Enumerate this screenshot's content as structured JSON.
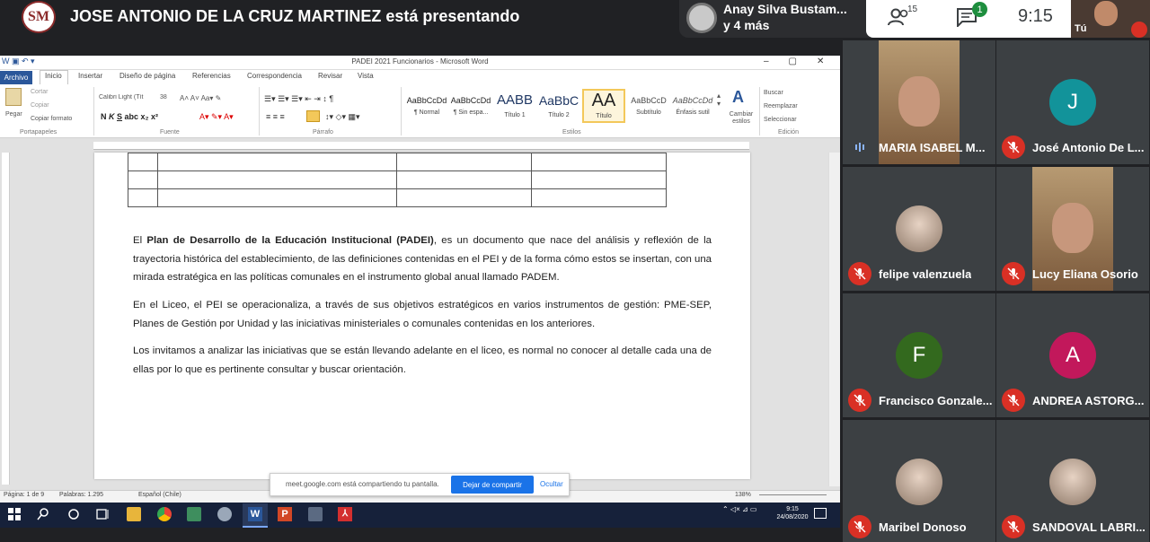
{
  "meet": {
    "presenter_text": "JOSE ANTONIO DE LA CRUZ MARTINEZ está presentando",
    "logo_text": "SM",
    "top_participant": {
      "name": "Anay Silva Bustam...",
      "more": "y 4 más"
    },
    "people_count": "15",
    "chat_badge": "1",
    "clock": "9:15",
    "self_label": "Tú"
  },
  "word": {
    "title": "PADEI 2021 Funcionarios - Microsoft Word",
    "tabs": [
      "Archivo",
      "Inicio",
      "Insertar",
      "Diseño de página",
      "Referencias",
      "Correspondencia",
      "Revisar",
      "Vista"
    ],
    "clipboard": {
      "paste": "Pegar",
      "cut": "Cortar",
      "copy": "Copiar",
      "format": "Copiar formato",
      "title": "Portapapeles"
    },
    "font": {
      "name": "Calibri Light (Tít",
      "size": "38",
      "title": "Fuente"
    },
    "paragraph_title": "Párrafo",
    "styles": [
      {
        "sample": "AaBbCcDd",
        "name": "¶ Normal"
      },
      {
        "sample": "AaBbCcDd",
        "name": "¶ Sin espa..."
      },
      {
        "sample": "AABB",
        "name": "Título 1"
      },
      {
        "sample": "AaBbC",
        "name": "Título 2"
      },
      {
        "sample": "AA",
        "name": "Título"
      },
      {
        "sample": "AaBbCcD",
        "name": "Subtítulo"
      },
      {
        "sample": "AaBbCcDd",
        "name": "Énfasis sutil"
      }
    ],
    "styles_title": "Estilos",
    "change_styles": "Cambiar estilos",
    "editing": {
      "find": "Buscar",
      "replace": "Reemplazar",
      "select": "Seleccionar",
      "title": "Edición"
    },
    "paragraphs": [
      {
        "pre": "El ",
        "bold": "Plan de Desarrollo de la Educación Institucional (PADEI)",
        "post": ", es un documento que nace del análisis y reflexión de la trayectoria histórica del establecimiento, de las definiciones contenidas en el PEI y de la forma cómo estos se insertan, con una mirada estratégica en las políticas comunales en el instrumento global anual llamado PADEM."
      },
      {
        "pre": "En el Liceo, el PEI se operacionaliza, a través de sus objetivos estratégicos en varios instrumentos de gestión: PME-SEP, Planes de Gestión por Unidad y las iniciativas ministeriales o comunales contenidas en los anteriores.",
        "bold": "",
        "post": ""
      },
      {
        "pre": "Los invitamos a analizar las iniciativas que se están llevando adelante en el liceo, es normal no conocer al detalle cada una de ellas por lo que es pertinente consultar y buscar orientación.",
        "bold": "",
        "post": ""
      }
    ],
    "status": {
      "page": "Página: 1 de 9",
      "words": "Palabras: 1.295",
      "language": "Español (Chile)",
      "zoom": "138%"
    },
    "share_banner": {
      "text": "meet.google.com está compartiendo tu pantalla.",
      "stop": "Dejar de compartir",
      "hide": "Ocultar"
    }
  },
  "taskbar": {
    "time": "9:15",
    "date": "24/08/2020"
  },
  "participants": [
    {
      "name": "MARIA ISABEL M...",
      "type": "video",
      "speaking": true
    },
    {
      "name": "José Antonio De L...",
      "type": "letter",
      "letter": "J",
      "color": "#12939a"
    },
    {
      "name": "felipe valenzuela",
      "type": "photo"
    },
    {
      "name": "Lucy Eliana Osorio",
      "type": "video"
    },
    {
      "name": "Francisco Gonzale...",
      "type": "letter",
      "letter": "F",
      "color": "#33691e"
    },
    {
      "name": "ANDREA ASTORG...",
      "type": "letter",
      "letter": "A",
      "color": "#c2185b"
    },
    {
      "name": "Maribel Donoso",
      "type": "photo"
    },
    {
      "name": "SANDOVAL LABRI...",
      "type": "photo"
    }
  ]
}
